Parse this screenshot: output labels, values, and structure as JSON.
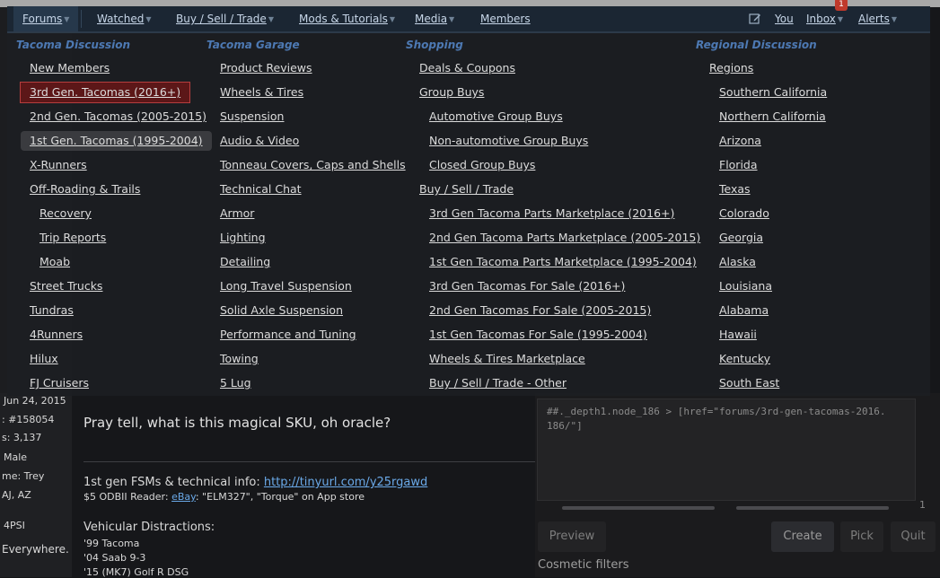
{
  "nav": {
    "items": [
      {
        "label": "Forums",
        "arrow": true
      },
      {
        "label": "Watched",
        "arrow": true
      },
      {
        "label": "Buy / Sell / Trade",
        "arrow": true
      },
      {
        "label": "Mods & Tutorials",
        "arrow": true
      },
      {
        "label": "Media",
        "arrow": true
      },
      {
        "label": "Members",
        "arrow": false
      }
    ],
    "right": [
      {
        "label": "You",
        "arrow": false
      },
      {
        "label": "Inbox",
        "arrow": true
      },
      {
        "label": "Alerts",
        "arrow": true
      }
    ],
    "inbox_badge": "1"
  },
  "menu": {
    "columns": [
      {
        "heading": "Tacoma Discussion",
        "links": [
          "New Members",
          "3rd Gen. Tacomas (2016+)",
          "2nd Gen. Tacomas (2005-2015)",
          "1st Gen. Tacomas (1995-2004)",
          "X-Runners",
          "Off-Roading & Trails",
          "Recovery",
          "Trip Reports",
          "Moab",
          "Street Trucks",
          "Tundras",
          "4Runners",
          "Hilux",
          "FJ Cruisers"
        ]
      },
      {
        "heading": "Tacoma Garage",
        "links": [
          "Product Reviews",
          "Wheels & Tires",
          "Suspension",
          "Audio & Video",
          "Tonneau Covers, Caps and Shells",
          "Technical Chat",
          "Armor",
          "Lighting",
          "Detailing",
          "Long Travel Suspension",
          "Solid Axle Suspension",
          "Performance and Tuning",
          "Towing",
          "5 Lug"
        ]
      },
      {
        "heading": "Shopping",
        "links": [
          "Deals & Coupons",
          "Group Buys",
          "Automotive Group Buys",
          "Non-automotive Group Buys",
          "Closed Group Buys",
          "Buy / Sell / Trade",
          "3rd Gen Tacoma Parts Marketplace (2016+)",
          "2nd Gen Tacoma Parts Marketplace (2005-2015)",
          "1st Gen Tacoma Parts Marketplace (1995-2004)",
          "3rd Gen Tacomas For Sale (2016+)",
          "2nd Gen Tacomas For Sale (2005-2015)",
          "1st Gen Tacomas For Sale (1995-2004)",
          "Wheels & Tires Marketplace",
          "Buy / Sell / Trade - Other"
        ]
      },
      {
        "heading": "Regional Discussion",
        "links": [
          "Regions",
          "Southern California",
          "Northern California",
          "Arizona",
          "Florida",
          "Texas",
          "Colorado",
          "Georgia",
          "Alaska",
          "Louisiana",
          "Alabama",
          "Hawaii",
          "Kentucky",
          "South East"
        ]
      }
    ]
  },
  "post": {
    "text": "Pray tell, what is this magical SKU, oh oracle?",
    "sig_fsm_prefix": "1st gen FSMs & technical info: ",
    "sig_fsm_link": "http://tinyurl.com/y25rgawd",
    "sig_odb_prefix": "$5 ODBII Reader: ",
    "sig_odb_link": "eBay",
    "sig_odb_suffix": ": \"ELM327\", \"Torque\" on App store",
    "sig_vehicles_title": "Vehicular Distractions:",
    "vehicles": [
      "'99 Tacoma",
      "'04 Saab 9-3",
      "'15 (MK7) Golf R DSG"
    ]
  },
  "user_sidebar": {
    "joined": "Jun 24, 2015",
    "id": ": #158054",
    "posts": "s: 3,137",
    "gender": "Male",
    "name": "me: Trey",
    "location": "AJ, AZ",
    "psi": "4PSI",
    "everywhere": "Everywhere."
  },
  "devtools": {
    "code": "##._depth1.node_186 > [href=\"forums/3rd-gen-tacomas-2016.\n186/\"]",
    "line_num": "1",
    "preview": "Preview",
    "create": "Create",
    "pick": "Pick",
    "quit": "Quit",
    "filters_label": "Cosmetic filters"
  },
  "colors": {
    "nav_bg": "#1b2633",
    "heading_blue": "#4d79b3",
    "selected_red": "#b53e3e",
    "link_blue": "#6aa9e8"
  }
}
